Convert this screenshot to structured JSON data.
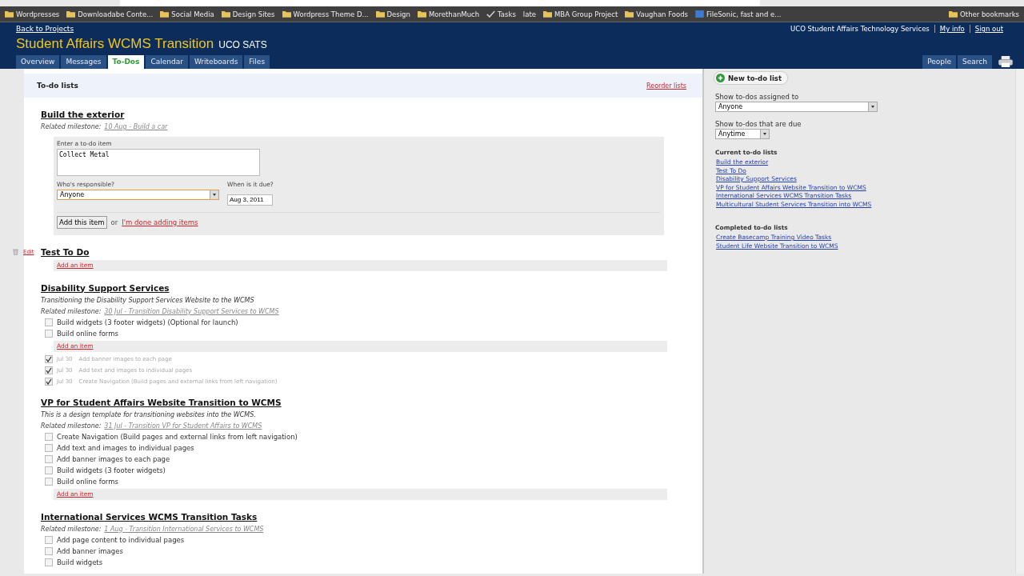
{
  "bookmarks": [
    {
      "label": "Wordpresses",
      "kind": "folder"
    },
    {
      "label": "Downloadabe Conte...",
      "kind": "folder"
    },
    {
      "label": "Social Media",
      "kind": "folder"
    },
    {
      "label": "Design Sites",
      "kind": "folder"
    },
    {
      "label": "Wordpress Theme D...",
      "kind": "folder"
    },
    {
      "label": "Design",
      "kind": "folder"
    },
    {
      "label": "MorethanMuch",
      "kind": "folder"
    },
    {
      "label": "Tasks",
      "kind": "check"
    },
    {
      "label": "late",
      "kind": "plain"
    },
    {
      "label": "MBA Group Project",
      "kind": "folder"
    },
    {
      "label": "Vaughan Foods",
      "kind": "folder"
    },
    {
      "label": "FileSonic, fast and e...",
      "kind": "site"
    }
  ],
  "other_bookmarks": "Other bookmarks",
  "header": {
    "back_link": "Back to Projects",
    "title": "Student Affairs WCMS Transition",
    "subtitle": "UCO SATS",
    "account": "UCO Student Affairs Technology Services",
    "my_info": "My info",
    "sign_out": "Sign out"
  },
  "tabs": [
    {
      "label": "Overview",
      "selected": false
    },
    {
      "label": "Messages",
      "selected": false
    },
    {
      "label": "To-Dos",
      "selected": true
    },
    {
      "label": "Calendar",
      "selected": false
    },
    {
      "label": "Writeboards",
      "selected": false
    },
    {
      "label": "Files",
      "selected": false
    }
  ],
  "right_tabs": [
    "People",
    "Search"
  ],
  "main": {
    "heading": "To-do lists",
    "reorder": "Reorder lists",
    "lists": [
      {
        "title": "Build the exterior",
        "milestone_label": "Related milestone:",
        "milestone": "10 Aug - Build a car",
        "form": {
          "item_label": "Enter a to-do item",
          "item_value": "Collect Metal",
          "who_label": "Who's responsible?",
          "who_value": "Anyone",
          "when_label": "When is it due?",
          "when_value": "Aug 3, 2011",
          "add_button": "Add this item",
          "or": "or",
          "done_link": "I'm done adding items"
        }
      },
      {
        "title": "Test To Do",
        "edit_link": "Edit",
        "add_link": "Add an item"
      },
      {
        "title": "Disability Support Services",
        "description": "Transitioning the Disability Support Services Website to the WCMS",
        "milestone_label": "Related milestone:",
        "milestone": "30 Jul - Transition Disability Support Services to WCMS",
        "items": [
          {
            "text": "Build widgets (3 footer widgets) (Optional for launch)",
            "checked": false
          },
          {
            "text": "Build online forms",
            "checked": false
          }
        ],
        "add_link": "Add an item",
        "completed": [
          {
            "date": "Jul 30",
            "text": "Add banner images to each page",
            "checked": true
          },
          {
            "date": "Jul 30",
            "text": "Add text and images to individual pages",
            "checked": true
          },
          {
            "date": "Jul 30",
            "text": "Create Navigation (Build pages and external links from left navigation)",
            "checked": true
          }
        ]
      },
      {
        "title": "VP for Student Affairs Website Transition to WCMS",
        "description": "This is a design template for transitioning websites into the WCMS.",
        "milestone_label": "Related milestone:",
        "milestone": "31 Jul - Transition VP for Student Affairs to WCMS",
        "items": [
          {
            "text": "Create Navigation (Build pages and external links from left navigation)",
            "checked": false
          },
          {
            "text": "Add text and images to individual pages",
            "checked": false
          },
          {
            "text": "Add banner images to each page",
            "checked": false
          },
          {
            "text": "Build widgets (3 footer widgets)",
            "checked": false
          },
          {
            "text": "Build online forms",
            "checked": false
          }
        ],
        "add_link": "Add an item"
      },
      {
        "title": "International Services WCMS Transition Tasks",
        "milestone_label": "Related milestone:",
        "milestone": "1 Aug - Transition International Services to WCMS",
        "items": [
          {
            "text": "Add page content to individual pages",
            "checked": false
          },
          {
            "text": "Add banner images",
            "checked": false
          },
          {
            "text": "Build widgets",
            "checked": false
          }
        ]
      }
    ]
  },
  "sidebar": {
    "new_button": "New to-do list",
    "assigned_label": "Show to-dos assigned to",
    "assigned_value": "Anyone",
    "due_label": "Show to-dos that are due",
    "due_value": "Anytime",
    "current_heading": "Current to-do lists",
    "current": [
      "Build the exterior",
      "Test To Do",
      "Disability Support Services",
      "VP for Student Affairs Website Transition to WCMS",
      "International Services WCMS Transition Tasks",
      "Multicultural Student Services Transition into WCMS"
    ],
    "completed_heading": "Completed to-do lists",
    "completed": [
      "Create Basecamp Training Video Tasks",
      "Student Life Website Transition to WCMS"
    ]
  }
}
